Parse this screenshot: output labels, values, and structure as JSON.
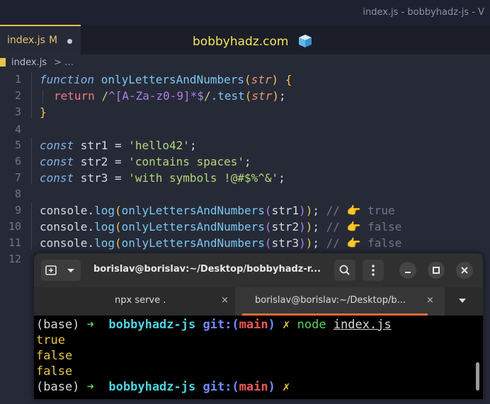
{
  "window": {
    "title": "index.js - bobbyhadz-js - V"
  },
  "editor_tab": {
    "label": "index.js",
    "modified": "M"
  },
  "brand": "bobbyhadz.com",
  "breadcrumb": {
    "file": "index.js",
    "separator": ">",
    "rest": "…"
  },
  "line_numbers": [
    "1",
    "2",
    "3",
    "4",
    "5",
    "6",
    "7",
    "8",
    "9",
    "10",
    "11",
    "12"
  ],
  "code": {
    "l1": {
      "kw": "function",
      "name": "onlyLettersAndNumbers",
      "open": "(",
      "param": "str",
      "close": ")",
      "brace": " {"
    },
    "l2": {
      "ret": "return",
      "slash1": "/",
      "caret": "^",
      "cls": "[A-Za-z0-9]",
      "star": "*",
      "dollar": "$",
      "slash2": "/",
      "method": ".test",
      "open": "(",
      "param": "str",
      "close": ")",
      "semi": ";"
    },
    "l3": {
      "brace": "}"
    },
    "l5": {
      "kw": "const",
      "name": " str1 = ",
      "val": "'hello42'",
      "semi": ";"
    },
    "l6": {
      "kw": "const",
      "name": " str2 = ",
      "val": "'contains spaces'",
      "semi": ";"
    },
    "l7": {
      "kw": "const",
      "name": " str3 = ",
      "val": "'with symbols !@#$%^&'",
      "semi": ";"
    },
    "l9": {
      "obj": "console",
      "dot": ".",
      "fn": "log",
      "open": "(",
      "call": "onlyLettersAndNumbers",
      "open2": "(",
      "arg": "str1",
      "close2": ")",
      "close": ")",
      "semi": ";",
      "comment": " // 👉 true"
    },
    "l10": {
      "obj": "console",
      "dot": ".",
      "fn": "log",
      "open": "(",
      "call": "onlyLettersAndNumbers",
      "open2": "(",
      "arg": "str2",
      "close2": ")",
      "close": ")",
      "semi": ";",
      "comment": " // 👉 false"
    },
    "l11": {
      "obj": "console",
      "dot": ".",
      "fn": "log",
      "open": "(",
      "call": "onlyLettersAndNumbers",
      "open2": "(",
      "arg": "str3",
      "close2": ")",
      "close": ")",
      "semi": ";",
      "comment": " // 👉 false"
    }
  },
  "terminal": {
    "title": "borislav@borislav:~/Desktop/bobbyhadz-r...",
    "tabs": [
      {
        "label": "npx serve .",
        "close": "×"
      },
      {
        "label": "borislav@borislav:~/Desktop/b...",
        "close": "×"
      }
    ],
    "prompt": {
      "env": "(base)",
      "arrow": "➜",
      "dir": "bobbyhadz-js",
      "git": "git:(",
      "branch": "main",
      "git_close": ")",
      "dirty": "✗"
    },
    "command": {
      "cmd": "node",
      "arg": "index.js"
    },
    "output": [
      "true",
      "false",
      "false"
    ]
  }
}
